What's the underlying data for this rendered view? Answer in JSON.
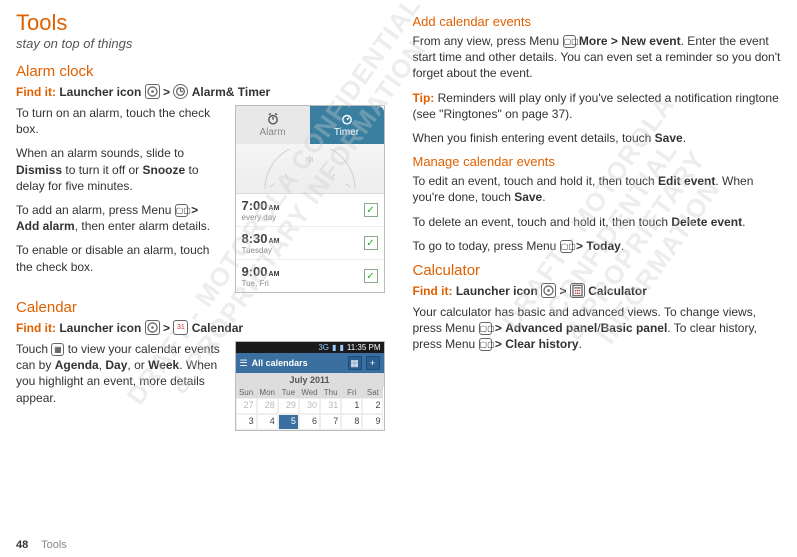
{
  "heading": "Tools",
  "subtitle": "stay on top of things",
  "watermark_line1": "DRAFT - MOTOROLA CONFIDENTIAL",
  "watermark_line2": "& PROPRIETARY INFORMATION",
  "alarm_clock": {
    "title": "Alarm clock",
    "findit_label": "Find it:",
    "findit_prefix": "Launcher icon",
    "findit_chev": ">",
    "findit_app": "Alarm& Timer",
    "p1a": "To turn on an alarm, touch the check box.",
    "p2a": "When an alarm sounds, slide to ",
    "p2b": "Dismiss",
    "p2c": " to turn it off or ",
    "p2d": "Snooze",
    "p2e": " to delay for five minutes.",
    "p3a": "To add an alarm, press Menu ",
    "p3chev": ">",
    "p3b": "Add alarm",
    "p3c": ", then enter alarm details.",
    "p4": "To enable or disable an alarm, touch the check box.",
    "widget": {
      "tab_alarm": "Alarm",
      "tab_timer": "Timer",
      "rows": [
        {
          "time": "7:00",
          "ampm": "AM",
          "sub": "every day"
        },
        {
          "time": "8:30",
          "ampm": "AM",
          "sub": "Tuesday"
        },
        {
          "time": "9:00",
          "ampm": "AM",
          "sub": "Tue, Fri"
        }
      ]
    }
  },
  "calendar": {
    "title": "Calendar",
    "findit_label": "Find it:",
    "findit_prefix": "Launcher icon",
    "findit_chev": ">",
    "findit_app": "Calendar",
    "p1a": "Touch ",
    "p1b": " to view your calendar events can by ",
    "p1c": "Agenda",
    "p1d": ", ",
    "p1e": "Day",
    "p1f": ", or ",
    "p1g": "Week",
    "p1h": ". When you highlight an event, more details appear.",
    "widget": {
      "status_3g": "3G",
      "status_time": "11:35 PM",
      "bar_title": "All calendars",
      "bar_plus": "+",
      "month": "July 2011",
      "dow": [
        "Sun",
        "Mon",
        "Tue",
        "Wed",
        "Thu",
        "Fri",
        "Sat"
      ],
      "row1": [
        "27",
        "28",
        "29",
        "30",
        "31",
        "1",
        "2"
      ],
      "row2": [
        "3",
        "4",
        "5",
        "6",
        "7",
        "8",
        "9"
      ]
    }
  },
  "add_events": {
    "title": "Add calendar events",
    "p1a": "From any view, press Menu ",
    "p1b": "More",
    "p1chev": ">",
    "p1c": "New event",
    "p1d": ". Enter the event start time and other details. You can even set a reminder so you don't forget about the event.",
    "tip_label": "Tip:",
    "tip_text": " Reminders will play only if you've selected a notification ringtone (see \"Ringtones\" on page 37).",
    "p2a": "When you finish entering event details, touch ",
    "p2b": "Save",
    "p2c": "."
  },
  "manage_events": {
    "title": "Manage calendar events",
    "p1a": "To edit an event, touch and hold it, then touch ",
    "p1b": "Edit event",
    "p1c": ". When you're done, touch ",
    "p1d": "Save",
    "p1e": ".",
    "p2a": "To delete an event, touch and hold it, then touch ",
    "p2b": "Delete event",
    "p2c": ".",
    "p3a": "To go to today, press Menu ",
    "p3chev": ">",
    "p3b": "Today",
    "p3c": "."
  },
  "calculator": {
    "title": "Calculator",
    "findit_label": "Find it:",
    "findit_prefix": "Launcher icon",
    "findit_chev": ">",
    "findit_app": "Calculator",
    "p1a": "Your calculator has basic and advanced views. To change views, press Menu ",
    "p1chev": ">",
    "p1b": "Advanced panel",
    "p1slash": "/",
    "p1c": "Basic panel",
    "p1d": ". To clear history, press Menu ",
    "p1e": "Clear history",
    "p1f": "."
  },
  "footer": {
    "page": "48",
    "section": "Tools"
  }
}
